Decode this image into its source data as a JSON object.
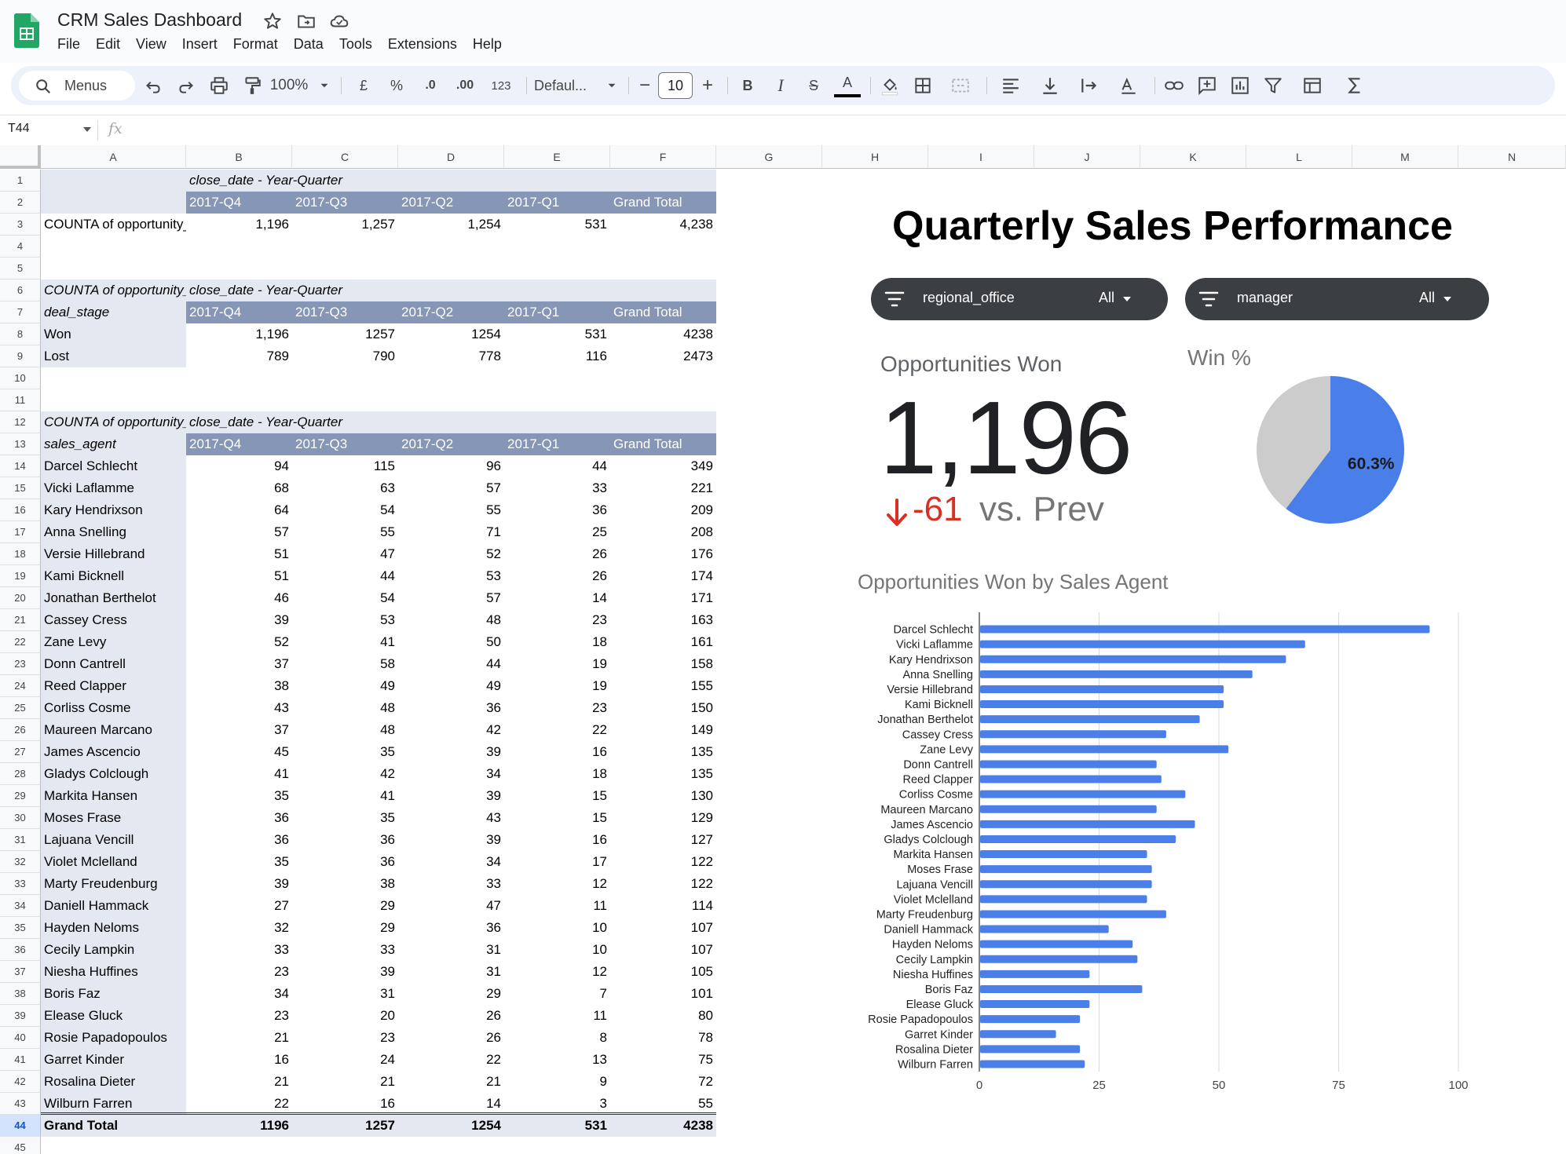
{
  "app": {
    "title": "CRM Sales Dashboard",
    "menu": [
      "File",
      "Edit",
      "View",
      "Insert",
      "Format",
      "Data",
      "Tools",
      "Extensions",
      "Help"
    ]
  },
  "toolbar": {
    "search_label": "Menus",
    "zoom": "100%",
    "currency": "£",
    "percent": "%",
    "decimal_decrease": ".0",
    "decimal_increase": ".00",
    "number_format": "123",
    "font": "Defaul...",
    "font_size": "10",
    "minus": "−",
    "plus": "+",
    "bold": "B",
    "italic": "I",
    "strike": "S",
    "text_color": "A"
  },
  "formula_bar": {
    "cell_ref": "T44",
    "fx": "fx"
  },
  "columns": [
    "A",
    "B",
    "C",
    "D",
    "E",
    "F",
    "G",
    "H",
    "I",
    "J",
    "K",
    "L",
    "M",
    "N"
  ],
  "pivot1": {
    "col_field": "close_date - Year-Quarter",
    "headers": [
      "2017-Q4",
      "2017-Q3",
      "2017-Q2",
      "2017-Q1",
      "Grand Total"
    ],
    "row_label": "COUNTA of opportunity_id",
    "values": [
      "1,196",
      "1,257",
      "1,254",
      "531",
      "4,238"
    ]
  },
  "pivot2": {
    "value_label": "COUNTA of opportunity_id",
    "col_field": "close_date - Year-Quarter",
    "row_field": "deal_stage",
    "headers": [
      "2017-Q4",
      "2017-Q3",
      "2017-Q2",
      "2017-Q1",
      "Grand Total"
    ],
    "rows": [
      {
        "label": "Won",
        "values": [
          "1,196",
          "1257",
          "1254",
          "531",
          "4238"
        ]
      },
      {
        "label": "Lost",
        "values": [
          "789",
          "790",
          "778",
          "116",
          "2473"
        ]
      }
    ]
  },
  "pivot3": {
    "value_label": "COUNTA of opportunity_id",
    "col_field": "close_date - Year-Quarter",
    "row_field": "sales_agent",
    "headers": [
      "2017-Q4",
      "2017-Q3",
      "2017-Q2",
      "2017-Q1",
      "Grand Total"
    ],
    "rows": [
      {
        "label": "Darcel Schlecht",
        "values": [
          "94",
          "115",
          "96",
          "44",
          "349"
        ]
      },
      {
        "label": "Vicki Laflamme",
        "values": [
          "68",
          "63",
          "57",
          "33",
          "221"
        ]
      },
      {
        "label": "Kary Hendrixson",
        "values": [
          "64",
          "54",
          "55",
          "36",
          "209"
        ]
      },
      {
        "label": "Anna Snelling",
        "values": [
          "57",
          "55",
          "71",
          "25",
          "208"
        ]
      },
      {
        "label": "Versie Hillebrand",
        "values": [
          "51",
          "47",
          "52",
          "26",
          "176"
        ]
      },
      {
        "label": "Kami Bicknell",
        "values": [
          "51",
          "44",
          "53",
          "26",
          "174"
        ]
      },
      {
        "label": "Jonathan Berthelot",
        "values": [
          "46",
          "54",
          "57",
          "14",
          "171"
        ]
      },
      {
        "label": "Cassey Cress",
        "values": [
          "39",
          "53",
          "48",
          "23",
          "163"
        ]
      },
      {
        "label": "Zane Levy",
        "values": [
          "52",
          "41",
          "50",
          "18",
          "161"
        ]
      },
      {
        "label": "Donn Cantrell",
        "values": [
          "37",
          "58",
          "44",
          "19",
          "158"
        ]
      },
      {
        "label": "Reed Clapper",
        "values": [
          "38",
          "49",
          "49",
          "19",
          "155"
        ]
      },
      {
        "label": "Corliss Cosme",
        "values": [
          "43",
          "48",
          "36",
          "23",
          "150"
        ]
      },
      {
        "label": "Maureen Marcano",
        "values": [
          "37",
          "48",
          "42",
          "22",
          "149"
        ]
      },
      {
        "label": "James Ascencio",
        "values": [
          "45",
          "35",
          "39",
          "16",
          "135"
        ]
      },
      {
        "label": "Gladys Colclough",
        "values": [
          "41",
          "42",
          "34",
          "18",
          "135"
        ]
      },
      {
        "label": "Markita Hansen",
        "values": [
          "35",
          "41",
          "39",
          "15",
          "130"
        ]
      },
      {
        "label": "Moses Frase",
        "values": [
          "36",
          "35",
          "43",
          "15",
          "129"
        ]
      },
      {
        "label": "Lajuana Vencill",
        "values": [
          "36",
          "36",
          "39",
          "16",
          "127"
        ]
      },
      {
        "label": "Violet Mclelland",
        "values": [
          "35",
          "36",
          "34",
          "17",
          "122"
        ]
      },
      {
        "label": "Marty Freudenburg",
        "values": [
          "39",
          "38",
          "33",
          "12",
          "122"
        ]
      },
      {
        "label": "Daniell Hammack",
        "values": [
          "27",
          "29",
          "47",
          "11",
          "114"
        ]
      },
      {
        "label": "Hayden Neloms",
        "values": [
          "32",
          "29",
          "36",
          "10",
          "107"
        ]
      },
      {
        "label": "Cecily Lampkin",
        "values": [
          "33",
          "33",
          "31",
          "10",
          "107"
        ]
      },
      {
        "label": "Niesha Huffines",
        "values": [
          "23",
          "39",
          "31",
          "12",
          "105"
        ]
      },
      {
        "label": "Boris Faz",
        "values": [
          "34",
          "31",
          "29",
          "7",
          "101"
        ]
      },
      {
        "label": "Elease Gluck",
        "values": [
          "23",
          "20",
          "26",
          "11",
          "80"
        ]
      },
      {
        "label": "Rosie Papadopoulos",
        "values": [
          "21",
          "23",
          "26",
          "8",
          "78"
        ]
      },
      {
        "label": "Garret Kinder",
        "values": [
          "16",
          "24",
          "22",
          "13",
          "75"
        ]
      },
      {
        "label": "Rosalina Dieter",
        "values": [
          "21",
          "21",
          "21",
          "9",
          "72"
        ]
      },
      {
        "label": "Wilburn Farren",
        "values": [
          "22",
          "16",
          "14",
          "3",
          "55"
        ]
      }
    ],
    "grand_total": {
      "label": "Grand Total",
      "values": [
        "1196",
        "1257",
        "1254",
        "531",
        "4238"
      ]
    }
  },
  "dashboard": {
    "title": "Quarterly Sales Performance",
    "filters": [
      {
        "name": "regional_office",
        "value": "All"
      },
      {
        "name": "manager",
        "value": "All"
      }
    ],
    "kpi": {
      "title": "Opportunities Won",
      "value": "1,196",
      "delta": "-61",
      "comparison": "vs. Prev"
    },
    "pie_title": "Win %",
    "bar_title": "Opportunities Won by Sales Agent"
  },
  "colors": {
    "pivot_header_dark": "#8596b7",
    "pivot_header_light": "#e4e8f0",
    "chart_blue": "#4a7ee8",
    "chart_grey": "#cccccc",
    "negative_red": "#d93025",
    "chip_bg": "#3b3e42"
  },
  "chart_data": [
    {
      "type": "pie",
      "title": "Win %",
      "slices": [
        {
          "label": "Won",
          "value": 60.3,
          "color": "#4a7ee8",
          "display": "60.3%"
        },
        {
          "label": "Lost",
          "value": 39.7,
          "color": "#cccccc"
        }
      ]
    },
    {
      "type": "bar",
      "orientation": "horizontal",
      "title": "Opportunities Won by Sales Agent",
      "categories": [
        "Darcel Schlecht",
        "Vicki Laflamme",
        "Kary Hendrixson",
        "Anna Snelling",
        "Versie Hillebrand",
        "Kami Bicknell",
        "Jonathan Berthelot",
        "Cassey Cress",
        "Zane Levy",
        "Donn Cantrell",
        "Reed Clapper",
        "Corliss Cosme",
        "Maureen Marcano",
        "James Ascencio",
        "Gladys Colclough",
        "Markita Hansen",
        "Moses Frase",
        "Lajuana Vencill",
        "Violet Mclelland",
        "Marty Freudenburg",
        "Daniell Hammack",
        "Hayden Neloms",
        "Cecily Lampkin",
        "Niesha Huffines",
        "Boris Faz",
        "Elease Gluck",
        "Rosie Papadopoulos",
        "Garret Kinder",
        "Rosalina Dieter",
        "Wilburn Farren"
      ],
      "values": [
        94,
        68,
        64,
        57,
        51,
        51,
        46,
        39,
        52,
        37,
        38,
        43,
        37,
        45,
        41,
        35,
        36,
        36,
        35,
        39,
        27,
        32,
        33,
        23,
        34,
        23,
        21,
        16,
        21,
        22
      ],
      "xlim": [
        0,
        100
      ],
      "xticks": [
        0,
        25,
        50,
        75,
        100
      ],
      "grid": true,
      "color": "#4a7ee8"
    }
  ]
}
